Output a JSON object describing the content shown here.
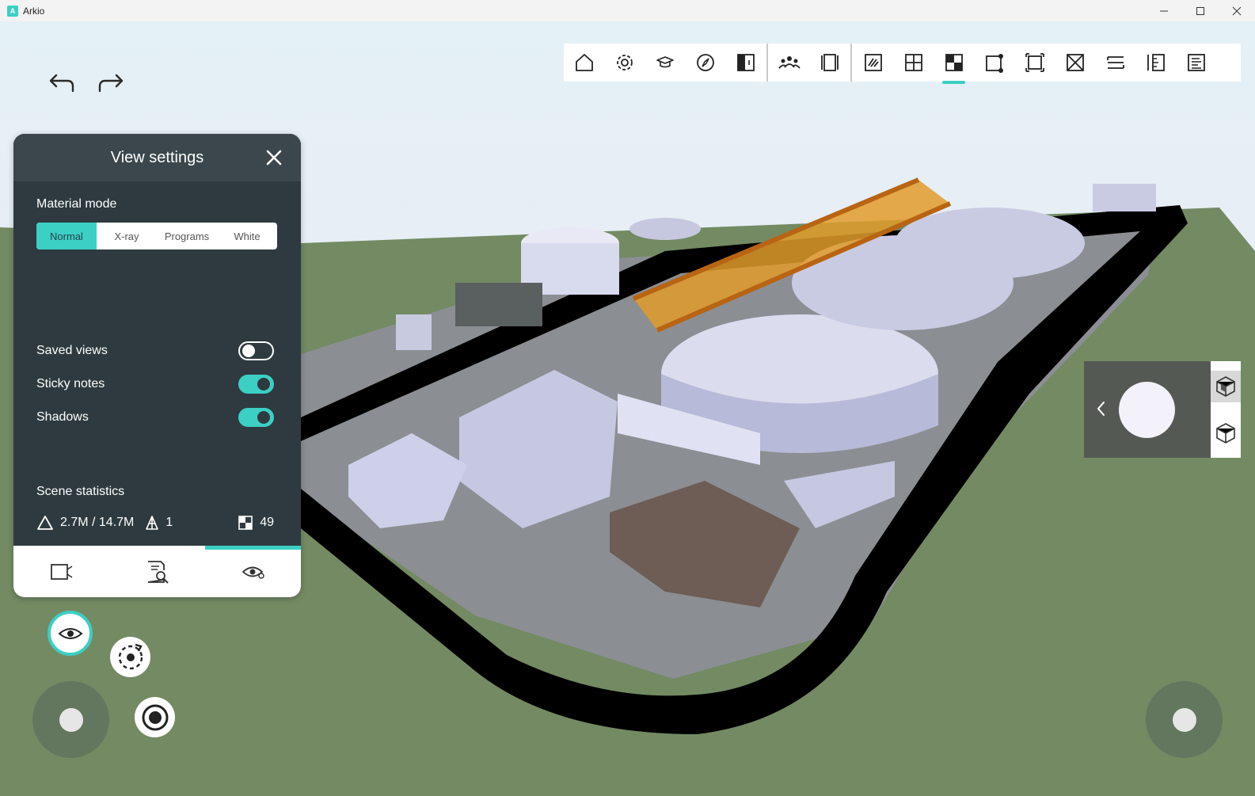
{
  "window": {
    "title": "Arkio",
    "controls": [
      "minimize",
      "maximize",
      "close"
    ]
  },
  "history": {
    "undo_icon": "undo-icon",
    "redo_icon": "redo-icon"
  },
  "toolbar": {
    "items": [
      {
        "id": "home",
        "icon": "home-icon"
      },
      {
        "id": "settings",
        "icon": "gear-icon"
      },
      {
        "id": "learn",
        "icon": "graduation-cap-icon"
      },
      {
        "id": "compass",
        "icon": "compass-icon"
      },
      {
        "id": "split-view",
        "icon": "split-view-icon"
      },
      {
        "id": "collaborate",
        "icon": "people-icon"
      },
      {
        "id": "panels",
        "icon": "panels-icon"
      },
      {
        "id": "sketch",
        "icon": "sketch-icon"
      },
      {
        "id": "grid",
        "icon": "grid-icon"
      },
      {
        "id": "view-settings",
        "icon": "checker-icon",
        "active": true
      },
      {
        "id": "resize",
        "icon": "resize-icon"
      },
      {
        "id": "select",
        "icon": "selection-icon"
      },
      {
        "id": "cut",
        "icon": "section-box-icon"
      },
      {
        "id": "section",
        "icon": "section-plane-icon"
      },
      {
        "id": "measure",
        "icon": "ruler-icon"
      },
      {
        "id": "properties",
        "icon": "document-icon"
      }
    ]
  },
  "panel": {
    "title": "View settings",
    "material_mode": {
      "label": "Material mode",
      "options": [
        "Normal",
        "X-ray",
        "Programs",
        "White"
      ],
      "selected": "Normal"
    },
    "toggles": [
      {
        "label": "Saved views",
        "on": false
      },
      {
        "label": "Sticky notes",
        "on": true
      },
      {
        "label": "Shadows",
        "on": true
      }
    ],
    "statistics": {
      "label": "Scene statistics",
      "triangles": "2.7M / 14.7M",
      "objects": "1",
      "materials": "49"
    },
    "footer_tabs": [
      {
        "icon": "camera-icon",
        "active": false
      },
      {
        "icon": "inspect-document-icon",
        "active": false
      },
      {
        "icon": "eye-settings-icon",
        "active": true
      }
    ]
  },
  "colors": {
    "accent": "#3ccfc4",
    "panel": "#2e3a3f",
    "ground": "#738a63"
  }
}
